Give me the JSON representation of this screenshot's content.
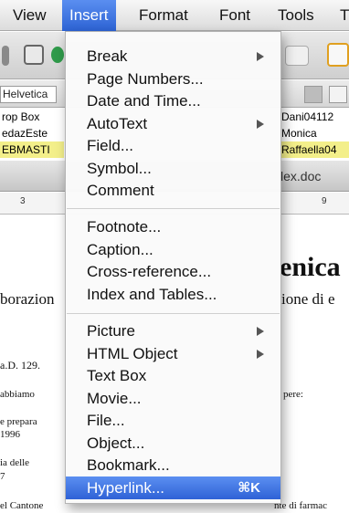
{
  "menubar": {
    "items": [
      "View",
      "Insert",
      "Format",
      "Font",
      "Tools",
      "T"
    ]
  },
  "toolbar": {
    "font_name": "Helvetica"
  },
  "style_list": [
    "rop Box",
    "edazEste",
    "EBMASTI"
  ],
  "autotext_list": [
    "Dani04112",
    "Monica",
    "Raffaella04"
  ],
  "document": {
    "filename": "lex.doc",
    "ruler_ticks": [
      "3",
      "9"
    ],
    "lines": [
      "enica",
      "borazion",
      "ione di e",
      "a.D. 129.",
      "abbiamo",
      "pere:",
      "e prepara",
      "1996",
      "ia  delle",
      "7",
      "el Cantone",
      "nte di farmac"
    ]
  },
  "insert_menu": {
    "section1": [
      {
        "label": "Break",
        "submenu": true
      },
      {
        "label": "Page Numbers..."
      },
      {
        "label": "Date and Time..."
      },
      {
        "label": "AutoText",
        "submenu": true
      },
      {
        "label": "Field..."
      },
      {
        "label": "Symbol..."
      },
      {
        "label": "Comment"
      }
    ],
    "section2": [
      {
        "label": "Footnote..."
      },
      {
        "label": "Caption..."
      },
      {
        "label": "Cross-reference..."
      },
      {
        "label": "Index and Tables..."
      }
    ],
    "section3": [
      {
        "label": "Picture",
        "submenu": true
      },
      {
        "label": "HTML Object",
        "submenu": true
      },
      {
        "label": "Text Box"
      },
      {
        "label": "Movie..."
      },
      {
        "label": "File..."
      },
      {
        "label": "Object..."
      },
      {
        "label": "Bookmark..."
      },
      {
        "label": "Hyperlink...",
        "shortcut": "⌘K",
        "highlighted": true
      }
    ]
  },
  "colors": {
    "menu_highlight": "#3a6fe0",
    "autotext_highlight": "#f3ef8a"
  }
}
